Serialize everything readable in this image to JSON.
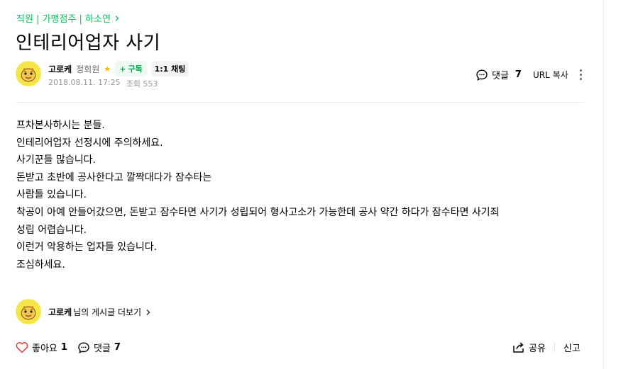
{
  "breadcrumb": {
    "path": "직원 | 가맹점주 | 하소연",
    "chevron_icon": "chevron-right-icon"
  },
  "post": {
    "title": "인테리어업자 사기"
  },
  "author": {
    "nickname": "고로케",
    "grade": "정회원",
    "grade_icon": "star-icon",
    "subscribe_label": "구독",
    "chat_label": "1:1 채팅",
    "date": "2018.08.11. 17:25",
    "views_label": "조회 553"
  },
  "top_actions": {
    "comment_label": "댓글",
    "comment_count": "7",
    "url_copy_label": "URL 복사"
  },
  "content": {
    "lines": [
      "프차본사하시는 분들.",
      "인테리어업자 선정시에 주의하세요.",
      "사기꾼들 많습니다.",
      "돈받고 초반에 공사한다고 깔짝대다가 잠수타는",
      "사람들 있습니다.",
      "착공이 아예 안들어갔으면, 돈받고 잠수타면 사기가 성립되어 형사고소가 가능한데 공사 약간 하다가 잠수타면 사기죄",
      "성립 어렵습니다.",
      "이런거 악용하는 업자들 있습니다.",
      "조심하세요."
    ]
  },
  "more_posts": {
    "nickname": "고로케",
    "suffix": "님의 게시글 더보기"
  },
  "bottom_actions": {
    "like_label": "좋아요",
    "like_count": "1",
    "comment_label": "댓글",
    "comment_count": "7",
    "share_label": "공유",
    "report_label": "신고"
  },
  "colors": {
    "accent_green": "#03c75a",
    "like_red": "#e13d3d",
    "star_yellow": "#f5b800"
  }
}
